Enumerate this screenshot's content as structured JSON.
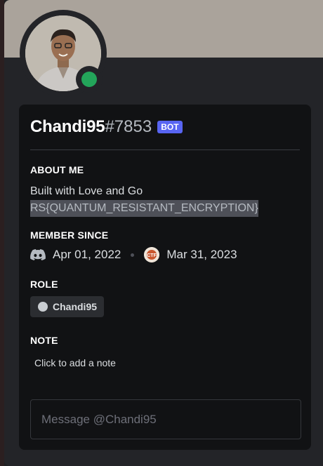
{
  "profile": {
    "username": "Chandi95",
    "discriminator": "#7853",
    "bot_tag": "BOT",
    "status": "online"
  },
  "about": {
    "title": "ABOUT ME",
    "line1": "Built with Love and Go",
    "line2": "RS{QUANTUM_RESISTANT_ENCRYPTION}"
  },
  "member_since": {
    "title": "MEMBER SINCE",
    "discord_date": "Apr 01, 2022",
    "server_date": "Mar 31, 2023"
  },
  "role": {
    "title": "ROLE",
    "name": "Chandi95"
  },
  "note": {
    "title": "NOTE",
    "placeholder": "Click to add a note"
  },
  "message": {
    "placeholder": "Message @Chandi95"
  },
  "colors": {
    "banner": "#aaa39b",
    "status_online": "#23a55a",
    "bot_tag": "#5865f2",
    "card_bg": "#111214"
  },
  "icons": {
    "discord": "discord-logo-icon",
    "server": "server-icon"
  }
}
